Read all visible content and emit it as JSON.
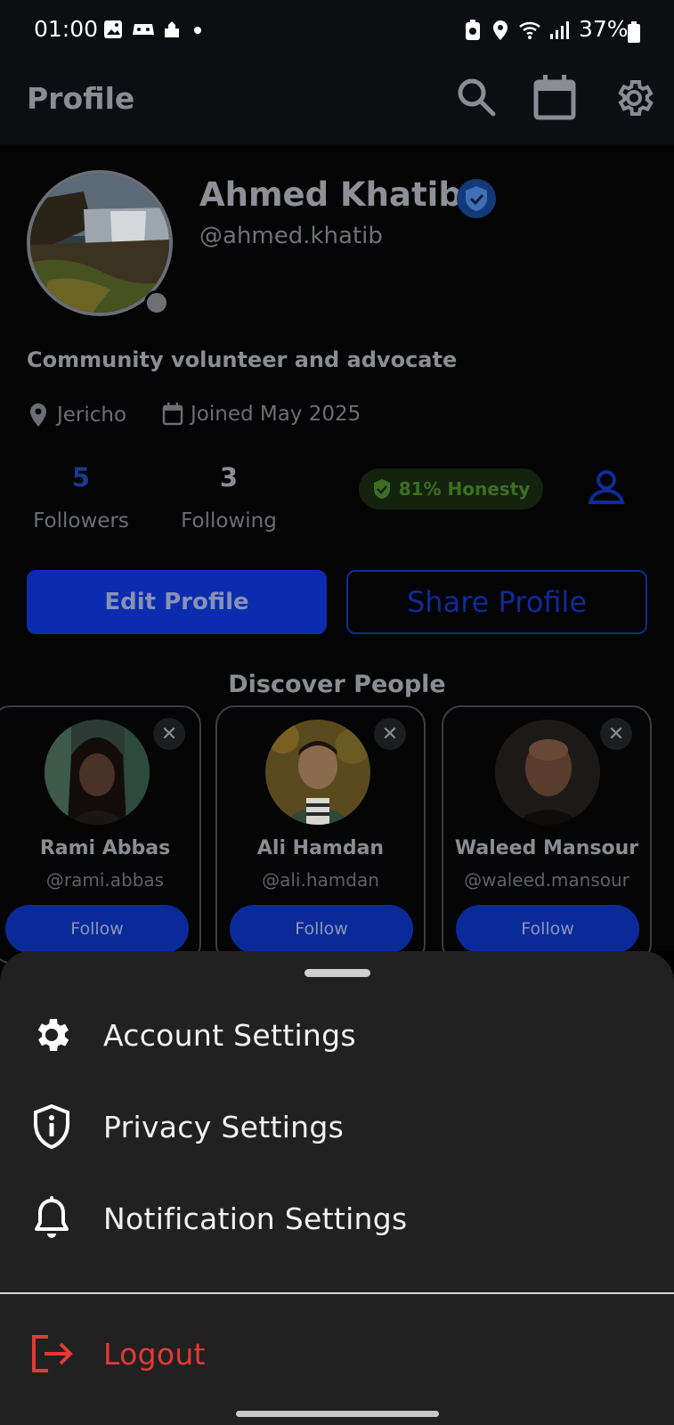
{
  "status_bar": {
    "time": "01:00",
    "battery": "37%"
  },
  "app_bar": {
    "title": "Profile",
    "icons": [
      "search-icon",
      "calendar-icon",
      "gear-icon"
    ]
  },
  "profile": {
    "name": "Ahmed Khatib",
    "username": "@ahmed.khatib",
    "bio": "Community volunteer and advocate",
    "location": "Jericho",
    "joined": "Joined May 2025",
    "followers_count": "5",
    "followers_label": "Followers",
    "following_count": "3",
    "following_label": "Following",
    "honesty": "81% Honesty",
    "edit_label": "Edit Profile",
    "share_label": "Share Profile"
  },
  "discover": {
    "title": "Discover People",
    "people": [
      {
        "name": "Rami Abbas",
        "handle": "@rami.abbas",
        "follow_label": "Follow"
      },
      {
        "name": "Ali Hamdan",
        "handle": "@ali.hamdan",
        "follow_label": "Follow"
      },
      {
        "name": "Waleed Mansour",
        "handle": "@waleed.mansour",
        "follow_label": "Follow"
      }
    ]
  },
  "settings_sheet": {
    "items": [
      {
        "label": "Account Settings",
        "icon": "gear-icon"
      },
      {
        "label": "Privacy Settings",
        "icon": "shield-info-icon"
      },
      {
        "label": "Notification Settings",
        "icon": "bell-icon"
      }
    ],
    "logout": {
      "label": "Logout",
      "icon": "logout-icon",
      "color": "#e53935"
    }
  },
  "colors": {
    "accent": "#0b2cae",
    "sheet_bg": "#212121",
    "danger": "#e53935"
  }
}
